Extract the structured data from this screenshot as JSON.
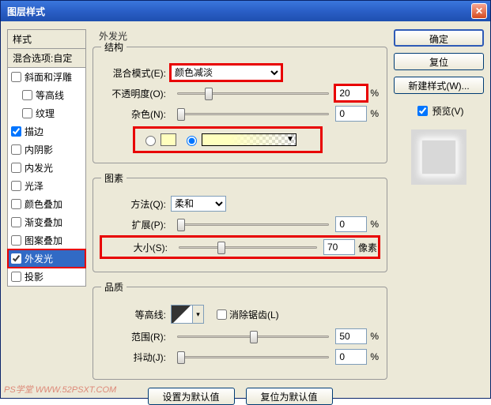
{
  "window": {
    "title": "图层样式"
  },
  "sidebar": {
    "header": "样式",
    "sub": "混合选项:自定",
    "items": [
      {
        "label": "斜面和浮雕",
        "checked": false,
        "indent": false
      },
      {
        "label": "等高线",
        "checked": false,
        "indent": true
      },
      {
        "label": "纹理",
        "checked": false,
        "indent": true
      },
      {
        "label": "描边",
        "checked": true,
        "indent": false
      },
      {
        "label": "内阴影",
        "checked": false,
        "indent": false
      },
      {
        "label": "内发光",
        "checked": false,
        "indent": false
      },
      {
        "label": "光泽",
        "checked": false,
        "indent": false
      },
      {
        "label": "颜色叠加",
        "checked": false,
        "indent": false
      },
      {
        "label": "渐变叠加",
        "checked": false,
        "indent": false
      },
      {
        "label": "图案叠加",
        "checked": false,
        "indent": false
      },
      {
        "label": "外发光",
        "checked": true,
        "indent": false,
        "selected": true
      },
      {
        "label": "投影",
        "checked": false,
        "indent": false
      }
    ]
  },
  "panel": {
    "title": "外发光",
    "structure": {
      "legend": "结构",
      "blendMode": {
        "label": "混合模式(E):",
        "value": "颜色减淡"
      },
      "opacity": {
        "label": "不透明度(O):",
        "value": "20",
        "unit": "%",
        "thumb": 18
      },
      "noise": {
        "label": "杂色(N):",
        "value": "0",
        "unit": "%",
        "thumb": 0
      },
      "colorRadio": "solid_or_gradient"
    },
    "elements": {
      "legend": "图素",
      "technique": {
        "label": "方法(Q):",
        "value": "柔和"
      },
      "spread": {
        "label": "扩展(P):",
        "value": "0",
        "unit": "%",
        "thumb": 0
      },
      "size": {
        "label": "大小(S):",
        "value": "70",
        "unit": "像素",
        "thumb": 28
      }
    },
    "quality": {
      "legend": "品质",
      "contour": {
        "label": "等高线:"
      },
      "antialias": {
        "label": "消除锯齿(L)",
        "checked": false
      },
      "range": {
        "label": "范围(R):",
        "value": "50",
        "unit": "%",
        "thumb": 48
      },
      "jitter": {
        "label": "抖动(J):",
        "value": "0",
        "unit": "%",
        "thumb": 0
      }
    },
    "defaults": {
      "set": "设置为默认值",
      "reset": "复位为默认值"
    }
  },
  "right": {
    "ok": "确定",
    "cancel": "复位",
    "newStyle": "新建样式(W)...",
    "preview": "预览(V)"
  },
  "watermark": "PS学堂  WWW.52PSXT.COM"
}
